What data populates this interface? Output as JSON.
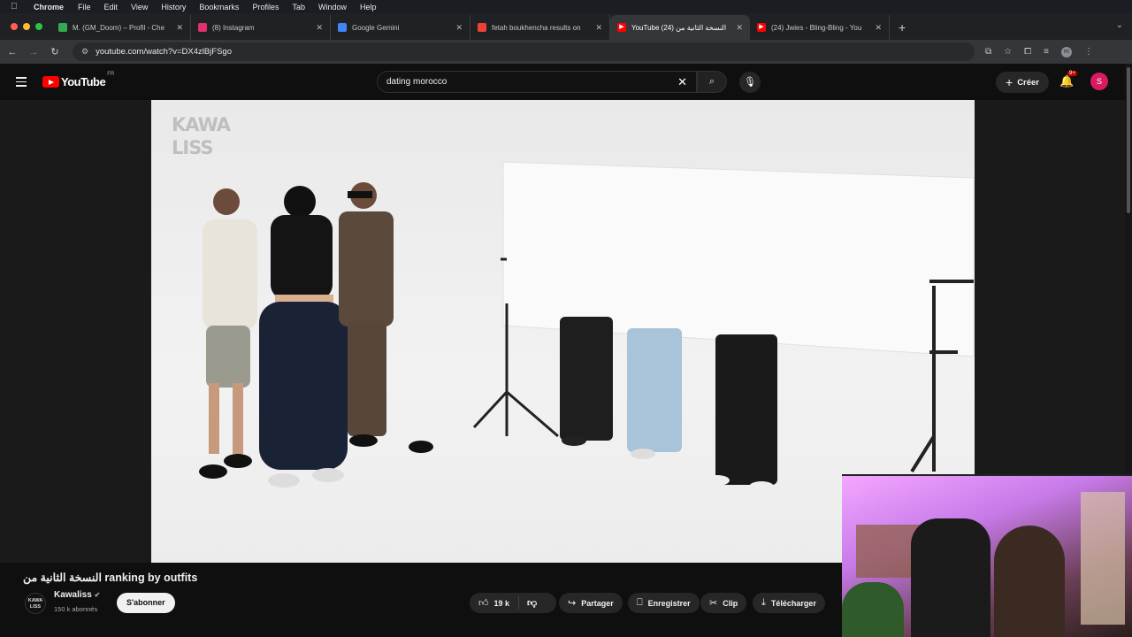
{
  "menubar": {
    "app": "Chrome",
    "items": [
      "File",
      "Edit",
      "View",
      "History",
      "Bookmarks",
      "Profiles",
      "Tab",
      "Window",
      "Help"
    ]
  },
  "tabs": [
    {
      "title": "M. (GM_Doom) – Profil - Che",
      "favicon_color": "#34a853",
      "active": false
    },
    {
      "title": "(8) Instagram",
      "favicon_color": "#e1306c",
      "active": false
    },
    {
      "title": "Google Gemini",
      "favicon_color": "#4285f4",
      "active": false
    },
    {
      "title": "fetah boukhencha results on",
      "favicon_color": "#ea4335",
      "active": false
    },
    {
      "title": "YouTube النسخة الثانية من (24)",
      "favicon_color": "#ff0000",
      "active": true
    },
    {
      "title": "(24) Jwies - Bling-Bling - You",
      "favicon_color": "#ff0000",
      "active": false
    }
  ],
  "address_bar": {
    "url": "youtube.com/watch?v=DX4zlBjFSgo"
  },
  "youtube": {
    "logo_text": "YouTube",
    "region": "FR",
    "search_value": "dating morocco",
    "create_label": "Créer",
    "notification_badge": "9+",
    "avatar_letter": "S"
  },
  "video": {
    "watermark_line1": "KAWA",
    "watermark_line2": "LISS",
    "title": "النسخة الثانية من ranking by outfits",
    "channel": {
      "name": "Kawaliss",
      "subscribers": "150 k abonnés",
      "logo_line1": "KAWA",
      "logo_line2": "LISS"
    },
    "subscribe_label": "S'abonner",
    "likes": "19 k",
    "actions": {
      "share": "Partager",
      "save": "Enregistrer",
      "clip": "Clip",
      "download": "Télécharger"
    }
  },
  "colors": {
    "yt_red": "#ff0000",
    "bg": "#0f0f0f",
    "avatar": "#d81b60"
  }
}
